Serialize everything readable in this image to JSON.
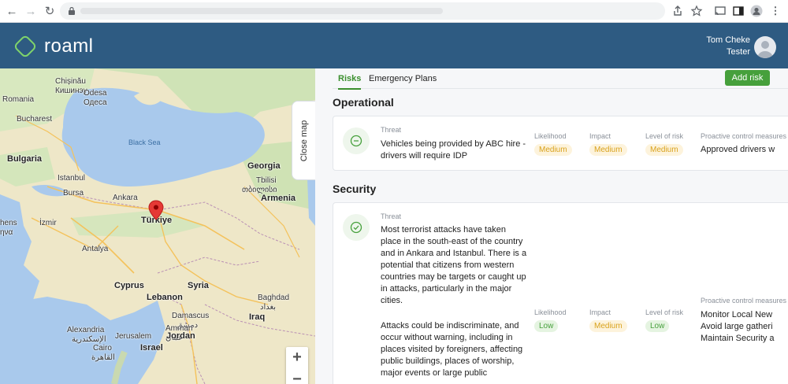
{
  "browser": {
    "back_icon": "arrow-left-icon",
    "forward_icon": "arrow-right-icon",
    "reload_icon": "reload-icon",
    "lock_icon": "lock-icon",
    "share_icon": "share-icon",
    "star_icon": "star-icon",
    "cast_icon": "cast-icon",
    "sidepanel_icon": "side-panel-icon",
    "profile_icon": "profile-icon",
    "menu_icon": "kebab-menu-icon"
  },
  "app": {
    "brand": "roaml",
    "user_name": "Tom Cheke",
    "user_role": "Tester",
    "colors": {
      "header": "#2e5b82",
      "accent": "#46a03c",
      "medium": "#d9a21c",
      "low": "#46a03c"
    }
  },
  "map": {
    "close_label": "Close map",
    "zoom_in": "+",
    "zoom_out": "−",
    "labels": {
      "chisinau": "Chișinău",
      "chisinau_cyr": "Кишинэу",
      "romania": "Romania",
      "odesa": "Odesa",
      "odesa_cyr": "Одеса",
      "bucharest": "Bucharest",
      "black_sea": "Black Sea",
      "bulgaria": "Bulgaria",
      "istanbul": "Istanbul",
      "georgia": "Georgia",
      "tbilisi": "Tbilisi",
      "tbilisi_geo": "თბილისი",
      "bursa": "Bursa",
      "ankara": "Ankara",
      "turkiye": "Türkiye",
      "armenia": "Armenia",
      "izmir": "İzmir",
      "athens": "hens",
      "athens2": "ηνα",
      "antalya": "Antalya",
      "cyprus": "Cyprus",
      "syria": "Syria",
      "lebanon": "Lebanon",
      "baghdad": "Baghdad",
      "baghdad_ar": "بغداد",
      "damascus": "Damascus",
      "damascus_ar": "دمشق",
      "iraq": "Iraq",
      "alexandria": "Alexandria",
      "alexandria_ar": "الإسكندرية",
      "jerusalem": "Jerusalem",
      "amman": "Amman",
      "amman_ar": "عمان",
      "israel": "Israel",
      "jordan": "Jordan",
      "cairo": "Cairo",
      "cairo_ar": "القاهرة"
    }
  },
  "panel": {
    "tabs": [
      {
        "label": "Risks",
        "active": true
      },
      {
        "label": "Emergency Plans",
        "active": false
      }
    ],
    "add_button": "Add risk",
    "sections": [
      {
        "title": "Operational",
        "risk": {
          "status_icon": "minus-circle-icon",
          "threat_label": "Threat",
          "threat": "Vehicles being provided by ABC hire - drivers will require IDP",
          "likelihood_label": "Likelihood",
          "likelihood": "Medium",
          "impact_label": "Impact",
          "impact": "Medium",
          "level_label": "Level of risk",
          "level": "Medium",
          "control_label": "Proactive control measures",
          "control": "Approved drivers w"
        }
      },
      {
        "title": "Security",
        "risk": {
          "status_icon": "check-circle-icon",
          "threat_label": "Threat",
          "threat_p1": "Most terrorist attacks have taken place in the south-east of the country and in Ankara and Istanbul. There is a potential that citizens from western countries may be targets or caught up in attacks, particularly in the major cities.",
          "threat_p2": "Attacks could be indiscriminate, and occur without warning, including in places visited by foreigners, affecting public buildings, places of worship, major events or large public",
          "likelihood_label": "Likelihood",
          "likelihood": "Low",
          "impact_label": "Impact",
          "impact": "Medium",
          "level_label": "Level of risk",
          "level": "Low",
          "control_label": "Proactive control measures",
          "control_lines": [
            "Monitor Local New",
            "Avoid large gatheri",
            "Maintain Security a"
          ]
        }
      }
    ]
  }
}
